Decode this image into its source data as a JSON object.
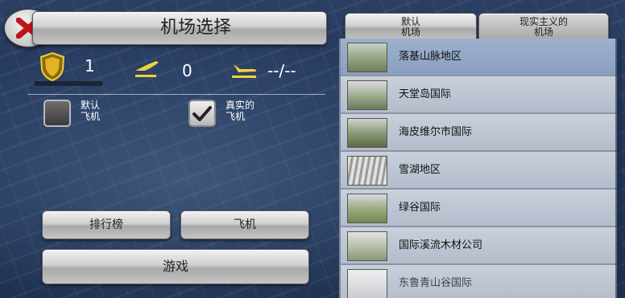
{
  "header": {
    "title": "机场选择"
  },
  "stats": {
    "level": "1",
    "flights": "0",
    "score": "--/--"
  },
  "options": {
    "default_plane": "默认\n飞机",
    "real_plane": "真实的\n飞机"
  },
  "tabs": [
    {
      "label": "默认\n机场"
    },
    {
      "label": "现实主义的\n机场"
    }
  ],
  "airports": [
    {
      "name": "落基山脉地区"
    },
    {
      "name": "天堂岛国际"
    },
    {
      "name": "海皮维尔市国际"
    },
    {
      "name": "雪湖地区"
    },
    {
      "name": "绿谷国际"
    },
    {
      "name": "国际溪流木材公司"
    },
    {
      "name": "东鲁青山谷国际"
    }
  ],
  "buttons": {
    "leaderboard": "排行榜",
    "plane": "飞机",
    "play": "游戏"
  },
  "colors": {
    "accent_yellow": "#f2d23a",
    "close_red": "#c0141b"
  }
}
